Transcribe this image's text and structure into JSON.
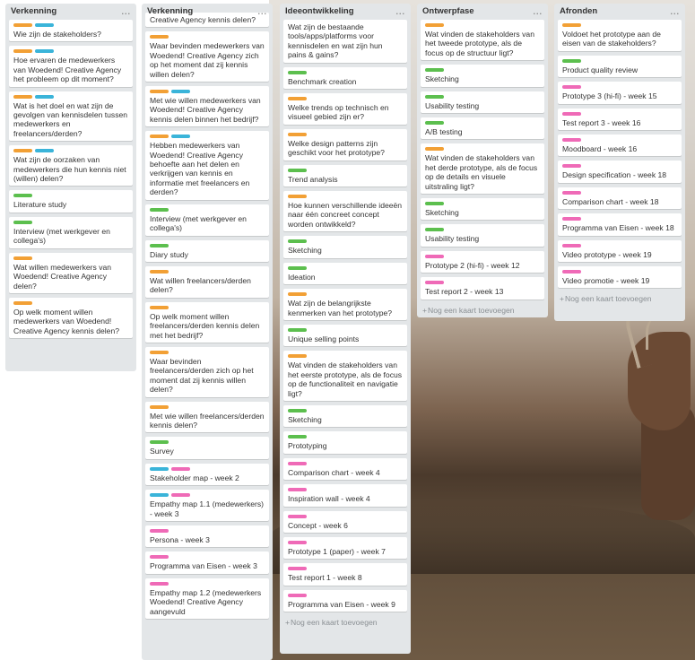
{
  "colors": {
    "orange": "#f2a035",
    "blue": "#3ab4d9",
    "green": "#5cbf4e",
    "pink": "#ef6ab7"
  },
  "add_card_label": "Nog een kaart toevoegen",
  "add_icon": "+",
  "menu_icon": "...",
  "columns": [
    {
      "title": "Verkenning",
      "cards": [
        {
          "labels": [
            "orange",
            "blue"
          ],
          "text": "Wie zijn de stakeholders?"
        },
        {
          "labels": [
            "orange",
            "blue"
          ],
          "text": "Hoe ervaren de medewerkers van Woedend! Creative Agency het probleem op dit moment?"
        },
        {
          "labels": [
            "orange",
            "blue"
          ],
          "text": "Wat is het doel en wat zijn de gevolgen van kennisdelen tussen medewerkers en freelancers/derden?"
        },
        {
          "labels": [
            "orange",
            "blue"
          ],
          "text": "Wat zijn de oorzaken van medewerkers die hun kennis niet (willen) delen?"
        },
        {
          "labels": [
            "green"
          ],
          "text": "Literature study"
        },
        {
          "labels": [
            "green"
          ],
          "text": "Interview (met werkgever en collega's)"
        },
        {
          "labels": [
            "orange"
          ],
          "text": "Wat willen medewerkers van Woedend! Creative Agency delen?"
        },
        {
          "labels": [
            "orange"
          ],
          "text": "Op welk moment willen medewerkers van Woedend! Creative Agency kennis delen?"
        }
      ]
    },
    {
      "title": "Verkenning",
      "cards": [
        {
          "labels": [],
          "text": "Creative Agency kennis delen?"
        },
        {
          "labels": [
            "orange"
          ],
          "text": "Waar bevinden medewerkers van Woedend! Creative Agency zich op het moment dat zij kennis willen delen?"
        },
        {
          "labels": [
            "orange",
            "blue"
          ],
          "text": "Met wie willen medewerkers van Woedend! Creative Agency kennis delen binnen het bedrijf?"
        },
        {
          "labels": [
            "orange",
            "blue"
          ],
          "text": "Hebben medewerkers van Woedend! Creative Agency behoefte aan het delen en verkrijgen van kennis en informatie met freelancers en derden?"
        },
        {
          "labels": [
            "green"
          ],
          "text": "Interview (met werkgever en collega's)"
        },
        {
          "labels": [
            "green"
          ],
          "text": "Diary study"
        },
        {
          "labels": [
            "orange"
          ],
          "text": "Wat willen freelancers/derden delen?"
        },
        {
          "labels": [
            "orange"
          ],
          "text": "Op welk moment willen freelancers/derden kennis delen met het bedrijf?"
        },
        {
          "labels": [
            "orange"
          ],
          "text": "Waar bevinden freelancers/derden zich op het moment dat zij kennis willen delen?"
        },
        {
          "labels": [
            "orange"
          ],
          "text": "Met wie willen freelancers/derden kennis delen?"
        },
        {
          "labels": [
            "green"
          ],
          "text": "Survey"
        },
        {
          "labels": [
            "blue",
            "pink"
          ],
          "text": "Stakeholder map - week 2"
        },
        {
          "labels": [
            "blue",
            "pink"
          ],
          "text": "Empathy map 1.1 (medewerkers) - week 3"
        },
        {
          "labels": [
            "pink"
          ],
          "text": "Persona - week 3"
        },
        {
          "labels": [
            "pink"
          ],
          "text": "Programma van Eisen - week 3"
        },
        {
          "labels": [
            "pink"
          ],
          "text": "Empathy map 1.2 (medewerkers Woedend! Creative Agency aangevuld"
        }
      ]
    },
    {
      "title": "Ideeontwikkeling",
      "cards": [
        {
          "labels": [],
          "text": "Wat zijn de bestaande tools/apps/platforms voor kennisdelen en wat zijn hun pains & gains?"
        },
        {
          "labels": [
            "green"
          ],
          "text": "Benchmark creation"
        },
        {
          "labels": [
            "orange"
          ],
          "text": "Welke trends op technisch en visueel gebied zijn er?"
        },
        {
          "labels": [
            "orange"
          ],
          "text": "Welke design patterns zijn geschikt voor het prototype?"
        },
        {
          "labels": [
            "green"
          ],
          "text": "Trend analysis"
        },
        {
          "labels": [
            "orange"
          ],
          "text": "Hoe kunnen verschillende ideeën naar één concreet concept worden ontwikkeld?"
        },
        {
          "labels": [
            "green"
          ],
          "text": "Sketching"
        },
        {
          "labels": [
            "green"
          ],
          "text": "Ideation"
        },
        {
          "labels": [
            "orange"
          ],
          "text": "Wat zijn de belangrijkste kenmerken van het prototype?"
        },
        {
          "labels": [
            "green"
          ],
          "text": "Unique selling points"
        },
        {
          "labels": [
            "orange"
          ],
          "text": "Wat vinden de stakeholders van het eerste prototype, als de focus op de functionaliteit en navigatie ligt?"
        },
        {
          "labels": [
            "green"
          ],
          "text": "Sketching"
        },
        {
          "labels": [
            "green"
          ],
          "text": "Prototyping"
        },
        {
          "labels": [
            "pink"
          ],
          "text": "Comparison chart - week 4"
        },
        {
          "labels": [
            "pink"
          ],
          "text": "Inspiration wall - week 4"
        },
        {
          "labels": [
            "pink"
          ],
          "text": "Concept - week 6"
        },
        {
          "labels": [
            "pink"
          ],
          "text": "Prototype 1 (paper) - week 7"
        },
        {
          "labels": [
            "pink"
          ],
          "text": "Test report 1 - week 8"
        },
        {
          "labels": [
            "pink"
          ],
          "text": "Programma van Eisen - week 9"
        }
      ],
      "show_add": true
    },
    {
      "title": "Ontwerpfase",
      "cards": [
        {
          "labels": [
            "orange"
          ],
          "text": "Wat vinden de stakeholders van het tweede prototype, als de focus op de structuur ligt?"
        },
        {
          "labels": [
            "green"
          ],
          "text": "Sketching"
        },
        {
          "labels": [
            "green"
          ],
          "text": "Usability testing"
        },
        {
          "labels": [
            "green"
          ],
          "text": "A/B testing"
        },
        {
          "labels": [
            "orange"
          ],
          "text": "Wat vinden de stakeholders van het derde prototype, als de focus op de details en visuele uitstraling ligt?"
        },
        {
          "labels": [
            "green"
          ],
          "text": "Sketching"
        },
        {
          "labels": [
            "green"
          ],
          "text": "Usability testing"
        },
        {
          "labels": [
            "pink"
          ],
          "text": "Prototype 2 (hi-fi) - week 12"
        },
        {
          "labels": [
            "pink"
          ],
          "text": "Test report 2 - week 13"
        }
      ],
      "show_add": true
    },
    {
      "title": "Afronden",
      "cards": [
        {
          "labels": [
            "orange"
          ],
          "text": "Voldoet het prototype aan de eisen van de stakeholders?"
        },
        {
          "labels": [
            "green"
          ],
          "text": "Product quality review"
        },
        {
          "labels": [
            "pink"
          ],
          "text": "Prototype 3 (hi-fi) - week 15"
        },
        {
          "labels": [
            "pink"
          ],
          "text": "Test report 3 - week 16"
        },
        {
          "labels": [
            "pink"
          ],
          "text": "Moodboard - week 16"
        },
        {
          "labels": [
            "pink"
          ],
          "text": "Design specification - week 18"
        },
        {
          "labels": [
            "pink"
          ],
          "text": "Comparison chart - week 18"
        },
        {
          "labels": [
            "pink"
          ],
          "text": "Programma van Eisen - week 18"
        },
        {
          "labels": [
            "pink"
          ],
          "text": "Video prototype - week 19"
        },
        {
          "labels": [
            "pink"
          ],
          "text": "Video promotie - week 19"
        }
      ],
      "show_add": true
    }
  ]
}
